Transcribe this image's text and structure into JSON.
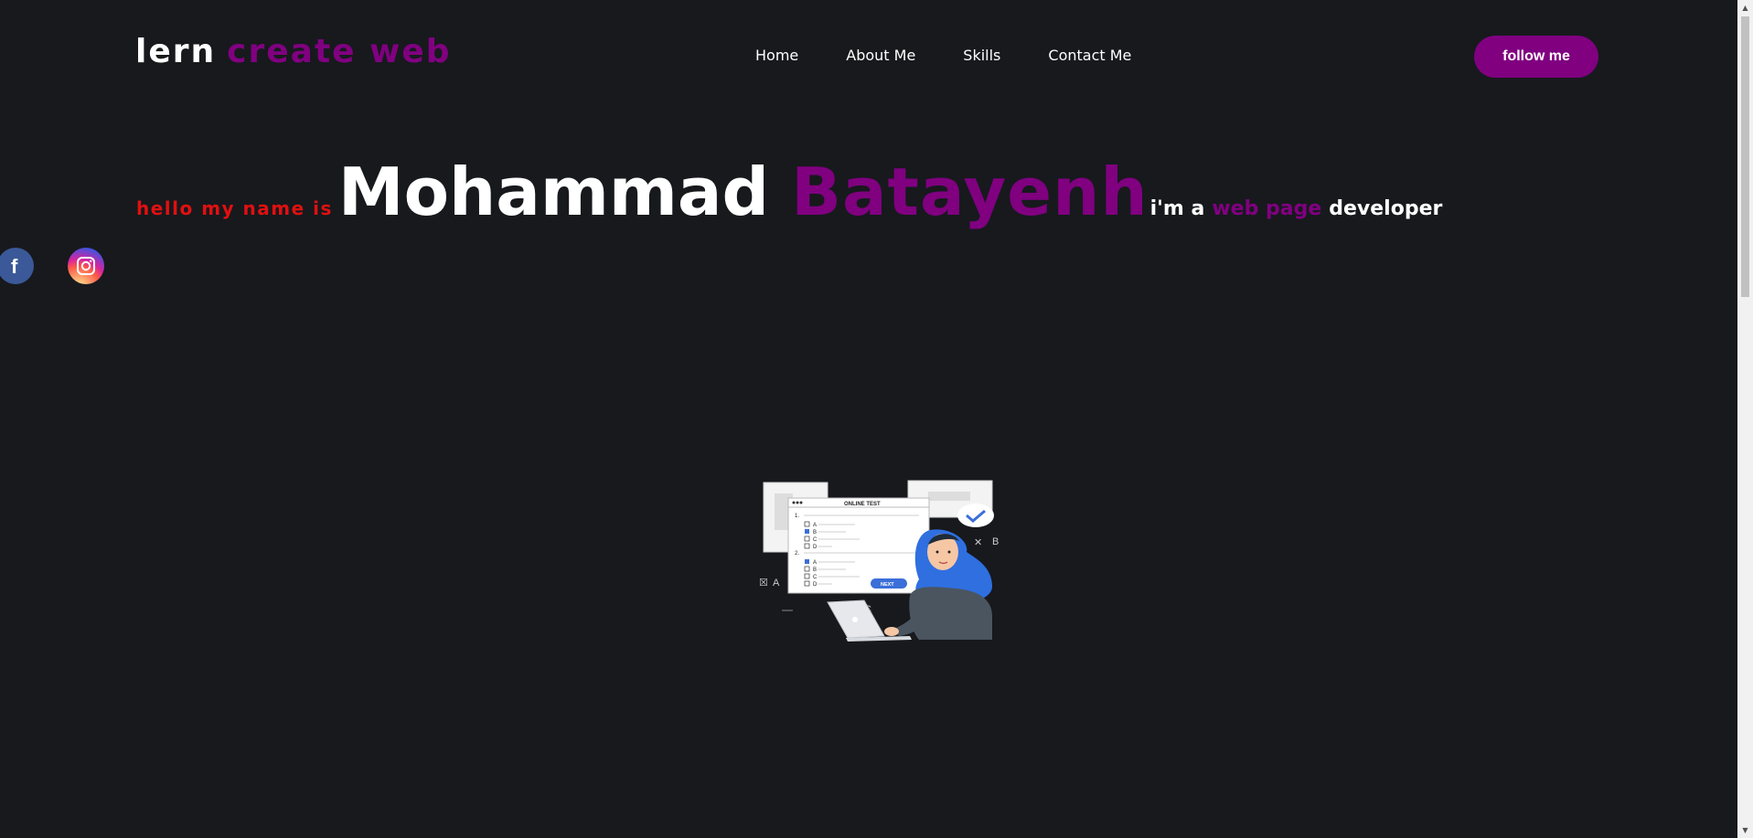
{
  "header": {
    "logo_part1": "lern",
    "logo_part2": "create web",
    "nav": [
      "Home",
      "About Me",
      "Skills",
      "Contact Me"
    ],
    "follow_label": "follow me"
  },
  "hero": {
    "hello": "hello my name is",
    "first_name": "Mohammad",
    "last_name": "Batayenh",
    "im_a": "i'm a",
    "web_page": "web page",
    "developer": "developer"
  },
  "social": {
    "facebook_icon": "facebook-icon",
    "instagram_icon": "instagram-icon"
  },
  "illustration": {
    "test_title": "ONLINE TEST",
    "next_label": "NEXT",
    "opt_a": "A",
    "opt_b": "B",
    "opt_c": "C",
    "opt_d": "D",
    "q1": "1.",
    "q2": "2."
  },
  "colors": {
    "background": "#17191d",
    "accent": "#800080",
    "hello_red": "#e01010"
  }
}
